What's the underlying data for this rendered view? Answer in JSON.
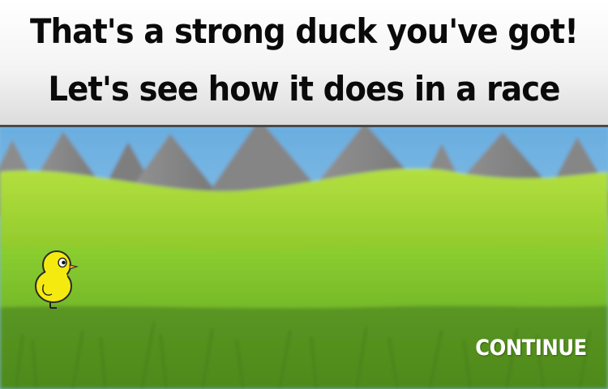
{
  "banner": {
    "line1": "That's a strong duck you've got!",
    "line2": "Let's see how it does in a race"
  },
  "actions": {
    "continue_label": "CONTINUE"
  },
  "colors": {
    "sky": "#7ab8e0",
    "mountain": "#8a8a8a",
    "far_hill": "#9fd22a",
    "mid_field": "#7cbf2a",
    "near_grass": "#5c9a22",
    "duck_body": "#f5ea10",
    "text": "#0a0a0a",
    "button_text": "#ffffff"
  }
}
